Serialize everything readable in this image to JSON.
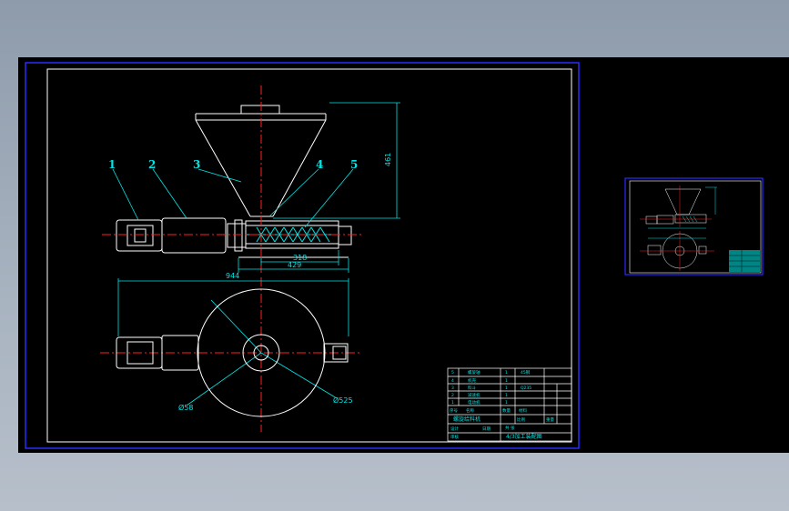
{
  "colors": {
    "background": "#000000",
    "frame_blue": "#2a2aff",
    "white": "#ffffff",
    "cyan": "#00e5e5",
    "red": "#ff2020",
    "yellow": "#ffff00"
  },
  "callouts": [
    "1",
    "2",
    "3",
    "4",
    "5"
  ],
  "dimensions": {
    "hopper_height": "461",
    "length_318": "318",
    "length_429": "429",
    "length_944": "944",
    "dia_small": "Ø58",
    "dia_large": "Ø525"
  },
  "title_block": {
    "rows": [
      {
        "no": "5",
        "name": "螺旋轴",
        "qty": "1",
        "mat": "45钢"
      },
      {
        "no": "4",
        "name": "机壳",
        "qty": "1",
        "mat": ""
      },
      {
        "no": "3",
        "name": "料斗",
        "qty": "1",
        "mat": "Q235"
      },
      {
        "no": "2",
        "name": "减速机",
        "qty": "1",
        "mat": ""
      },
      {
        "no": "1",
        "name": "电动机",
        "qty": "1",
        "mat": ""
      }
    ],
    "header": {
      "no": "序号",
      "name": "名称",
      "qty": "数量",
      "mat": "材料"
    },
    "drawing_name": "螺旋给料机",
    "labels": {
      "scale": "比例",
      "weight": "重量",
      "sheet": "共 张",
      "designer": "设计",
      "checker": "审核",
      "date": "日期"
    },
    "drawing_title": "4/3加工装配图"
  }
}
